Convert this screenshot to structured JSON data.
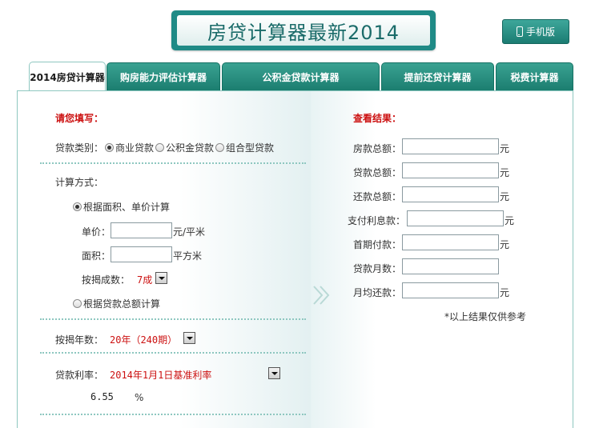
{
  "header": {
    "title": "房贷计算器最新2014",
    "mobile_button": "手机版"
  },
  "tabs": [
    {
      "label": "2014房贷计算器",
      "active": true
    },
    {
      "label": "购房能力评估计算器",
      "active": false
    },
    {
      "label": "公积金贷款计算器",
      "active": false
    },
    {
      "label": "提前还贷计算器",
      "active": false
    },
    {
      "label": "税费计算器",
      "active": false
    }
  ],
  "left": {
    "section_title": "请您填写：",
    "loan_type_label": "贷款类别：",
    "loan_types": [
      {
        "label": "商业贷款",
        "selected": true
      },
      {
        "label": "公积金贷款",
        "selected": false
      },
      {
        "label": "组合型贷款",
        "selected": false
      }
    ],
    "method_label": "计算方式：",
    "method_area": "根据面积、单价计算",
    "unit_price_label": "单价：",
    "unit_price_value": "",
    "unit_price_unit": "元/平米",
    "area_label": "面积：",
    "area_value": "",
    "area_unit": "平方米",
    "ratio_label": "按揭成数：",
    "ratio_value": "7成",
    "method_total": "根据贷款总额计算",
    "years_label": "按揭年数：",
    "years_value": "20年（240期）",
    "rate_label": "贷款利率：",
    "rate_option": "2014年1月1日基准利率",
    "rate_value": "6.55",
    "rate_unit": "%"
  },
  "right": {
    "section_title": "查看结果：",
    "fields": [
      {
        "label": "房款总额：",
        "unit": "元"
      },
      {
        "label": "贷款总额：",
        "unit": "元"
      },
      {
        "label": "还款总额：",
        "unit": "元"
      },
      {
        "label": "支付利息款：",
        "unit": "元"
      },
      {
        "label": "首期付款：",
        "unit": "元"
      },
      {
        "label": "贷款月数：",
        "unit": ""
      },
      {
        "label": "月均还款：",
        "unit": "元"
      }
    ],
    "note": "*以上结果仅供参考"
  },
  "colors": {
    "brand": "#1f8a86",
    "accent_red": "#cc1111",
    "border": "#8ec7c0"
  },
  "icons": {
    "mobile": "phone-icon",
    "dropdown": "chevron-down-icon",
    "divider": "double-chevron-right-icon"
  }
}
